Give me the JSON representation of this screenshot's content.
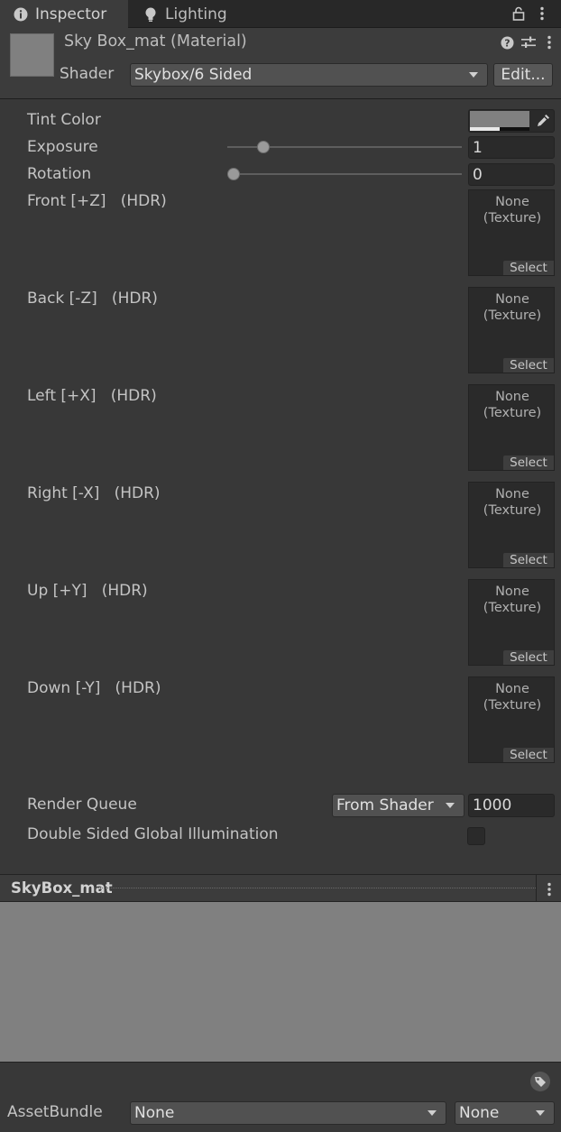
{
  "tabs": [
    {
      "label": "Inspector",
      "icon": "info-icon"
    },
    {
      "label": "Lighting",
      "icon": "lightbulb-icon"
    }
  ],
  "header": {
    "title": "Sky Box_mat (Material)",
    "shader_label": "Shader",
    "shader_value": "Skybox/6 Sided",
    "edit_label": "Edit..."
  },
  "properties": {
    "tint_color": {
      "label": "Tint Color",
      "color": "#808080"
    },
    "exposure": {
      "label": "Exposure",
      "value": "1",
      "slider_fraction": 0.125
    },
    "rotation": {
      "label": "Rotation",
      "value": "0",
      "slider_fraction": 0.0
    },
    "textures": [
      {
        "label": "Front [+Z]   (HDR)",
        "line1": "None",
        "line2": "(Texture)",
        "select": "Select"
      },
      {
        "label": "Back [-Z]   (HDR)",
        "line1": "None",
        "line2": "(Texture)",
        "select": "Select"
      },
      {
        "label": "Left [+X]   (HDR)",
        "line1": "None",
        "line2": "(Texture)",
        "select": "Select"
      },
      {
        "label": "Right [-X]   (HDR)",
        "line1": "None",
        "line2": "(Texture)",
        "select": "Select"
      },
      {
        "label": "Up [+Y]   (HDR)",
        "line1": "None",
        "line2": "(Texture)",
        "select": "Select"
      },
      {
        "label": "Down [-Y]   (HDR)",
        "line1": "None",
        "line2": "(Texture)",
        "select": "Select"
      }
    ],
    "render_queue": {
      "label": "Render Queue",
      "mode": "From Shader",
      "value": "1000"
    },
    "double_sided_gi": {
      "label": "Double Sided Global Illumination",
      "checked": false
    }
  },
  "preview": {
    "title": "SkyBox_mat",
    "color": "#808080"
  },
  "asset_bundle": {
    "label": "AssetBundle",
    "name": "None",
    "variant": "None"
  }
}
